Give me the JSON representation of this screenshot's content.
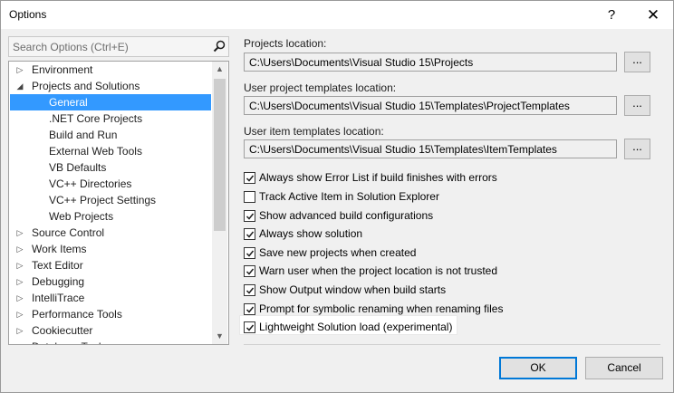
{
  "window": {
    "title": "Options",
    "help_label": "?",
    "close_label": "✕"
  },
  "search": {
    "placeholder": "Search Options (Ctrl+E)"
  },
  "tree": {
    "items": [
      {
        "label": "Environment",
        "level": 0,
        "arrow": "▷",
        "selected": false
      },
      {
        "label": "Projects and Solutions",
        "level": 0,
        "arrow": "◢",
        "selected": false
      },
      {
        "label": "General",
        "level": 1,
        "arrow": "",
        "selected": true
      },
      {
        "label": ".NET Core Projects",
        "level": 1,
        "arrow": "",
        "selected": false
      },
      {
        "label": "Build and Run",
        "level": 1,
        "arrow": "",
        "selected": false
      },
      {
        "label": "External Web Tools",
        "level": 1,
        "arrow": "",
        "selected": false
      },
      {
        "label": "VB Defaults",
        "level": 1,
        "arrow": "",
        "selected": false
      },
      {
        "label": "VC++ Directories",
        "level": 1,
        "arrow": "",
        "selected": false
      },
      {
        "label": "VC++ Project Settings",
        "level": 1,
        "arrow": "",
        "selected": false
      },
      {
        "label": "Web Projects",
        "level": 1,
        "arrow": "",
        "selected": false
      },
      {
        "label": "Source Control",
        "level": 0,
        "arrow": "▷",
        "selected": false
      },
      {
        "label": "Work Items",
        "level": 0,
        "arrow": "▷",
        "selected": false
      },
      {
        "label": "Text Editor",
        "level": 0,
        "arrow": "▷",
        "selected": false
      },
      {
        "label": "Debugging",
        "level": 0,
        "arrow": "▷",
        "selected": false
      },
      {
        "label": "IntelliTrace",
        "level": 0,
        "arrow": "▷",
        "selected": false
      },
      {
        "label": "Performance Tools",
        "level": 0,
        "arrow": "▷",
        "selected": false
      },
      {
        "label": "Cookiecutter",
        "level": 0,
        "arrow": "▷",
        "selected": false
      },
      {
        "label": "Database Tools",
        "level": 0,
        "arrow": "▷",
        "selected": false
      }
    ],
    "scroll_up": "▲",
    "scroll_down": "▼"
  },
  "locations": {
    "projects_label": "Projects location:",
    "projects_value": "C:\\Users\\Documents\\Visual Studio 15\\Projects",
    "user_templates_label": "User project templates location:",
    "user_templates_value": "C:\\Users\\Documents\\Visual Studio 15\\Templates\\ProjectTemplates",
    "item_templates_label": "User item templates location:",
    "item_templates_value": "C:\\Users\\Documents\\Visual Studio 15\\Templates\\ItemTemplates",
    "browse_label": "..."
  },
  "options": [
    {
      "label": "Always show Error List if build finishes with errors",
      "checked": true
    },
    {
      "label": "Track Active Item in Solution Explorer",
      "checked": false
    },
    {
      "label": "Show advanced build configurations",
      "checked": true
    },
    {
      "label": "Always show solution",
      "checked": true
    },
    {
      "label": "Save new projects when created",
      "checked": true
    },
    {
      "label": "Warn user when the project location is not trusted",
      "checked": true
    },
    {
      "label": "Show Output window when build starts",
      "checked": true
    },
    {
      "label": "Prompt for symbolic renaming when renaming files",
      "checked": true
    },
    {
      "label": "Lightweight Solution load (experimental)",
      "checked": true
    }
  ],
  "buttons": {
    "ok_label": "OK",
    "cancel_label": "Cancel"
  },
  "colors": {
    "selection": "#3399ff",
    "accent_border": "#0078d7"
  }
}
